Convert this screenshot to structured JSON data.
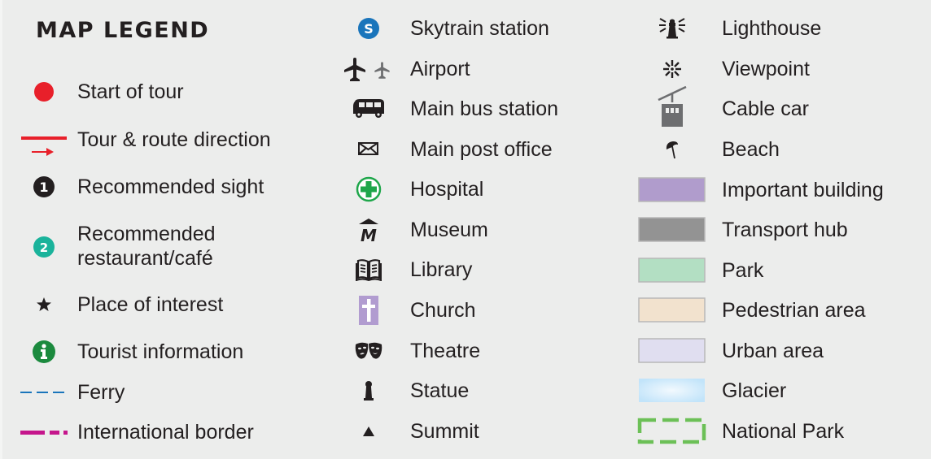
{
  "title": "MAP LEGEND",
  "colors": {
    "background": "#ecedec",
    "tour_red": "#e8202a",
    "sight_black": "#231f20",
    "restaurant_teal": "#1ab39b",
    "tourist_green": "#1b8a3e",
    "ferry_blue": "#1a75bb",
    "border_magenta": "#c5168c",
    "skytrain_blue": "#1a75bb",
    "hospital_green": "#1ea64a",
    "church_purple": "#b19cd0",
    "cablecar_gray": "#6d6e70",
    "important_building": "#b09ccc",
    "transport_hub": "#939393",
    "park": "#b3dfc3",
    "pedestrian_area": "#f2e2ce",
    "urban_area": "#e0def0",
    "glacier": "#c6e6fa",
    "national_park": "#6cc057"
  },
  "columns": [
    {
      "items": [
        {
          "icon": "red-dot-icon",
          "label": "Start of tour"
        },
        {
          "icon": "route-line-arrow-icon",
          "label": "Tour & route direction"
        },
        {
          "icon": "numbered-black-circle-icon",
          "badge": "1",
          "label": "Recommended sight"
        },
        {
          "icon": "numbered-teal-circle-icon",
          "badge": "2",
          "label_line1": "Recommended",
          "label_line2": "restaurant/café"
        },
        {
          "icon": "star-icon",
          "glyph": "★",
          "label": "Place of interest"
        },
        {
          "icon": "info-icon",
          "glyph": "i",
          "label": "Tourist information"
        },
        {
          "icon": "ferry-dashed-line-icon",
          "label": "Ferry"
        },
        {
          "icon": "border-dash-dot-line-icon",
          "label": "International border"
        }
      ]
    },
    {
      "items": [
        {
          "icon": "skytrain-icon",
          "glyph": "S",
          "label": "Skytrain station"
        },
        {
          "icon": "airport-icon",
          "label": "Airport"
        },
        {
          "icon": "bus-icon",
          "label": "Main bus station"
        },
        {
          "icon": "envelope-icon",
          "label": "Main post office"
        },
        {
          "icon": "hospital-cross-icon",
          "label": "Hospital"
        },
        {
          "icon": "museum-icon",
          "glyph": "M",
          "label": "Museum"
        },
        {
          "icon": "library-book-icon",
          "label": "Library"
        },
        {
          "icon": "church-cross-icon",
          "label": "Church"
        },
        {
          "icon": "theatre-masks-icon",
          "label": "Theatre"
        },
        {
          "icon": "statue-icon",
          "label": "Statue"
        },
        {
          "icon": "summit-triangle-icon",
          "glyph": "▲",
          "label": "Summit"
        }
      ]
    },
    {
      "items": [
        {
          "icon": "lighthouse-icon",
          "label": "Lighthouse"
        },
        {
          "icon": "viewpoint-icon",
          "label": "Viewpoint"
        },
        {
          "icon": "cable-car-icon",
          "label": "Cable car"
        },
        {
          "icon": "beach-umbrella-icon",
          "label": "Beach"
        },
        {
          "icon": "important-building-swatch",
          "label": "Important building"
        },
        {
          "icon": "transport-hub-swatch",
          "label": "Transport hub"
        },
        {
          "icon": "park-swatch",
          "label": "Park"
        },
        {
          "icon": "pedestrian-area-swatch",
          "label": "Pedestrian area"
        },
        {
          "icon": "urban-area-swatch",
          "label": "Urban area"
        },
        {
          "icon": "glacier-swatch",
          "label": "Glacier"
        },
        {
          "icon": "national-park-swatch",
          "label": "National Park"
        }
      ]
    }
  ]
}
